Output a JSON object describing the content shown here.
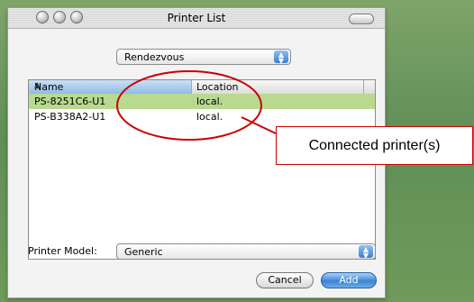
{
  "window": {
    "title": "Printer List"
  },
  "connection_popup": {
    "value": "Rendezvous"
  },
  "printer_table": {
    "columns": [
      "Name",
      "Location"
    ],
    "sort_indicator": "▲",
    "rows": [
      {
        "name": "PS-8251C6-U1",
        "location": "local."
      },
      {
        "name": "PS-B338A2-U1",
        "location": "local."
      }
    ]
  },
  "printer_model": {
    "label": "Printer Model:",
    "value": "Generic"
  },
  "buttons": {
    "cancel": "Cancel",
    "add": "Add"
  },
  "annotation": {
    "text": "Connected printer(s)",
    "color": "#cc0000"
  },
  "colors": {
    "selected_row": "#b8d98f",
    "accent": "#3d83d4"
  }
}
